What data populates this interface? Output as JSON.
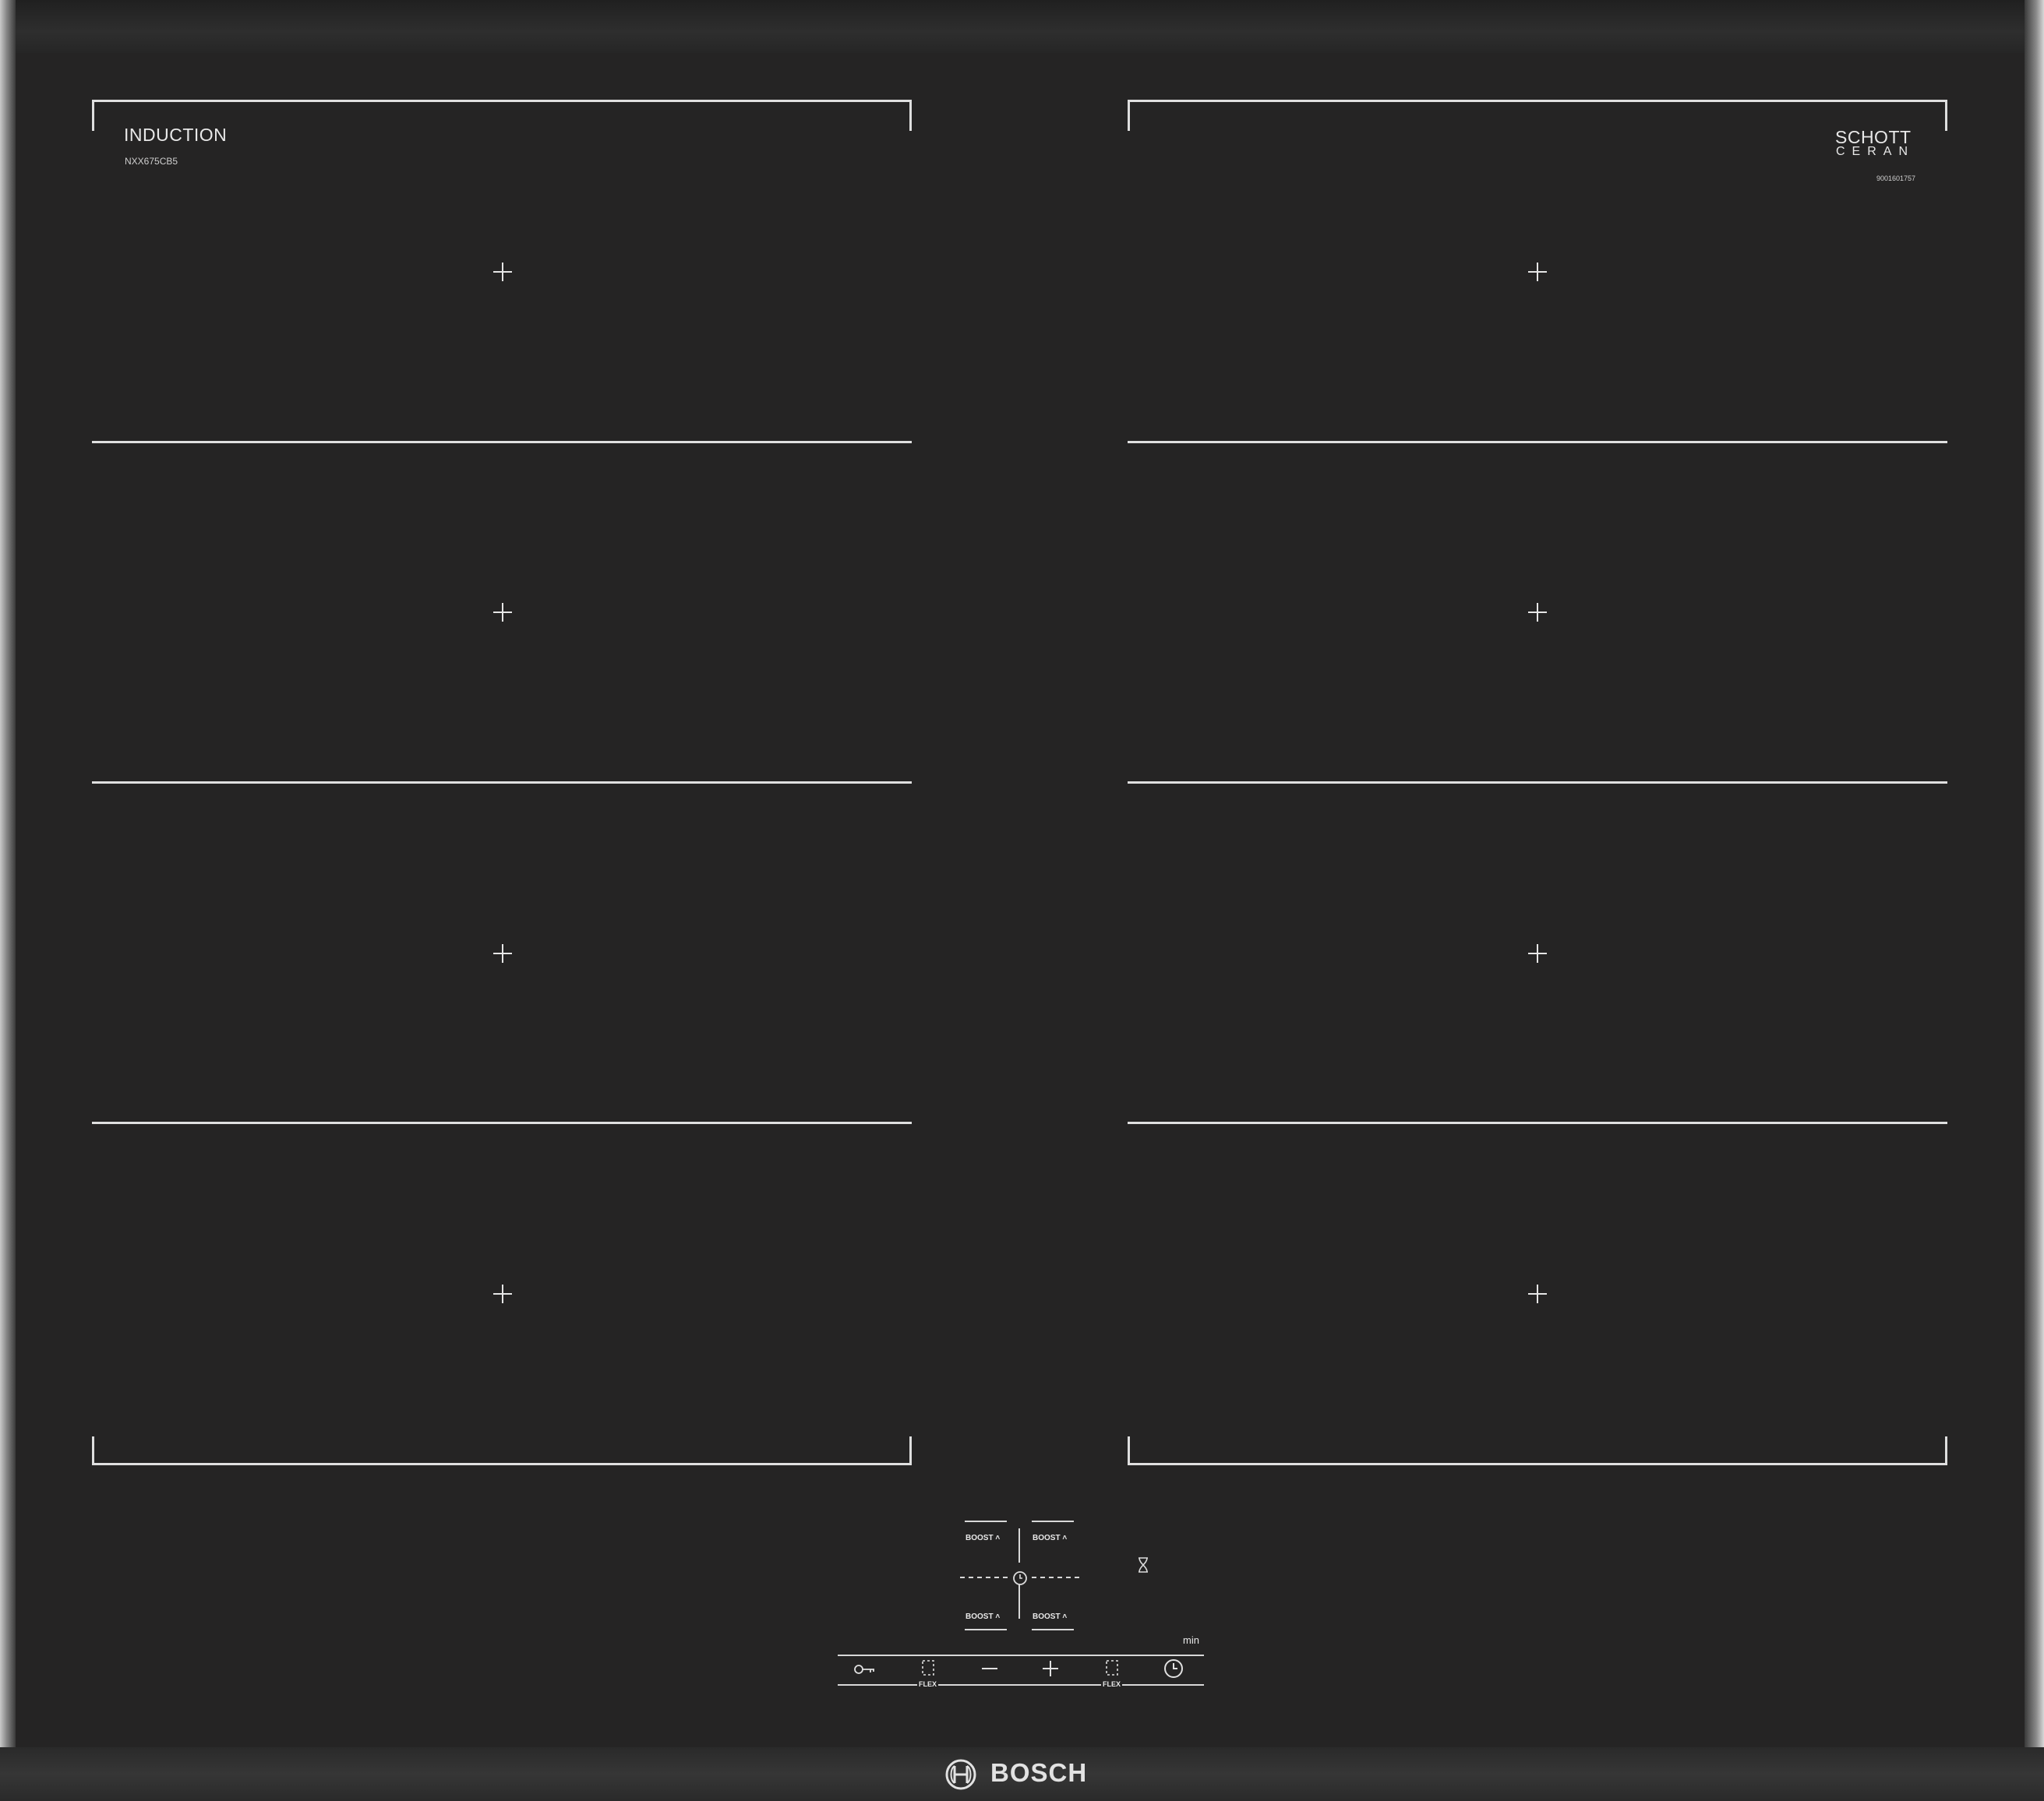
{
  "brand": {
    "product_type": "INDUCTION",
    "model": "NXX675CB5",
    "manufacturer": "BOSCH"
  },
  "glass": {
    "maker_line1": "SCHOTT",
    "maker_line2": "CERAN",
    "serial": "9001601757"
  },
  "controls": {
    "boost_label": "BOOST",
    "flex_label": "FLEX",
    "timer_unit": "min",
    "buttons": [
      {
        "name": "key-lock",
        "icon": "key-icon"
      },
      {
        "name": "flex-left",
        "icon": "flex-left-icon"
      },
      {
        "name": "minus",
        "icon": "minus-icon"
      },
      {
        "name": "plus",
        "icon": "plus-icon"
      },
      {
        "name": "flex-right",
        "icon": "flex-right-icon"
      },
      {
        "name": "timer",
        "icon": "clock-icon"
      }
    ]
  },
  "colors": {
    "glass": "#252424",
    "markings": "#e0e0e0",
    "frame": "#8a8a8a"
  }
}
